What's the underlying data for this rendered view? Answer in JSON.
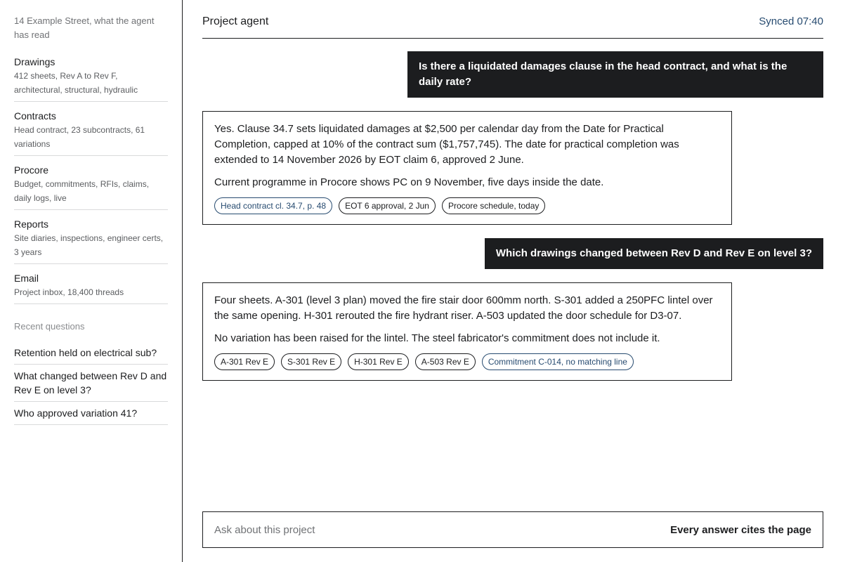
{
  "sidebar": {
    "heading": "14 Example Street, what the agent has read",
    "sources": [
      {
        "title": "Drawings",
        "desc": "412 sheets, Rev A to Rev F, architectural, structural, hydraulic"
      },
      {
        "title": "Contracts",
        "desc": "Head contract, 23 subcontracts, 61 variations"
      },
      {
        "title": "Procore",
        "desc": "Budget, commitments, RFIs, claims, daily logs, live"
      },
      {
        "title": "Reports",
        "desc": "Site diaries, inspections, engineer certs, 3 years"
      },
      {
        "title": "Email",
        "desc": "Project inbox, 18,400 threads"
      }
    ],
    "recent_heading": "Recent questions",
    "recent": [
      "Retention held on electrical sub?",
      "What changed between Rev D and Rev E on level 3?",
      "Who approved variation 41?"
    ]
  },
  "header": {
    "title": "Project agent",
    "sync": "Synced 07:40"
  },
  "conversation": {
    "q1": "Is there a liquidated damages clause in the head contract, and what is the daily rate?",
    "a1": {
      "p1": "Yes. Clause 34.7 sets liquidated damages at $2,500 per calendar day from the Date for Practical Completion, capped at 10% of the contract sum ($1,757,745). The date for practical completion was extended to 14 November 2026 by EOT claim 6, approved 2 June.",
      "p2": "Current programme in Procore shows PC on 9 November, five days inside the date.",
      "citations": [
        "Head contract cl. 34.7, p. 48",
        "EOT 6 approval, 2 Jun",
        "Procore schedule, today"
      ]
    },
    "q2": "Which drawings changed between Rev D and Rev E on level 3?",
    "a2": {
      "p1": "Four sheets. A-301 (level 3 plan) moved the fire stair door 600mm north. S-301 added a 250PFC lintel over the same opening. H-301 rerouted the fire hydrant riser. A-503 updated the door schedule for D3-07.",
      "p2": "No variation has been raised for the lintel. The steel fabricator's commitment does not include it.",
      "citations": [
        "A-301 Rev E",
        "S-301 Rev E",
        "H-301 Rev E",
        "A-503 Rev E",
        "Commitment C-014, no matching line"
      ]
    }
  },
  "composer": {
    "placeholder": "Ask about this project",
    "note": "Every answer cites the page"
  },
  "colors": {
    "ink": "#1c1d1f",
    "accent": "#274b70",
    "muted": "#707275",
    "divider": "#d9dadb"
  }
}
